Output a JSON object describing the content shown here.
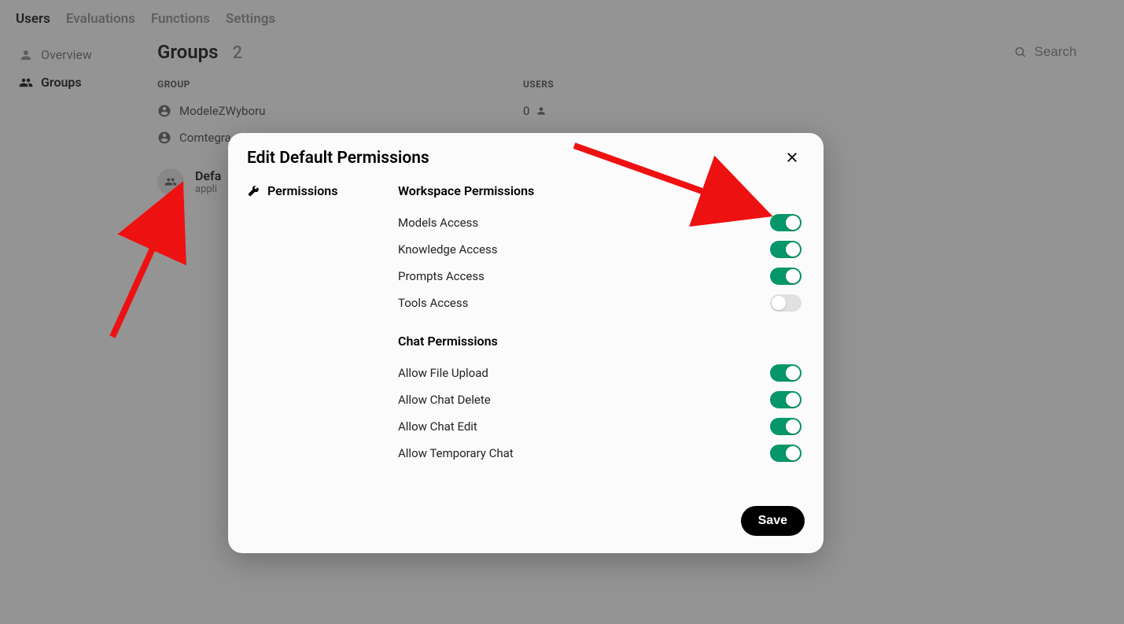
{
  "topnav": {
    "users": "Users",
    "evaluations": "Evaluations",
    "functions": "Functions",
    "settings": "Settings"
  },
  "sidebar": {
    "overview": "Overview",
    "groups": "Groups"
  },
  "page": {
    "title": "Groups",
    "count": "2"
  },
  "search": {
    "placeholder": "Search"
  },
  "table": {
    "head_group": "GROUP",
    "head_users": "USERS",
    "rows": [
      {
        "name": "ModeleZWyboru",
        "users": "0"
      },
      {
        "name": "Comtegra",
        "users": ""
      }
    ]
  },
  "default_block": {
    "title": "Defa",
    "sub": "appli"
  },
  "modal": {
    "title": "Edit Default Permissions",
    "side_permissions": "Permissions",
    "section_workspace": "Workspace Permissions",
    "section_chat": "Chat Permissions",
    "workspace": [
      {
        "label": "Models Access",
        "on": true
      },
      {
        "label": "Knowledge Access",
        "on": true
      },
      {
        "label": "Prompts Access",
        "on": true
      },
      {
        "label": "Tools Access",
        "on": false
      }
    ],
    "chat": [
      {
        "label": "Allow File Upload",
        "on": true
      },
      {
        "label": "Allow Chat Delete",
        "on": true
      },
      {
        "label": "Allow Chat Edit",
        "on": true
      },
      {
        "label": "Allow Temporary Chat",
        "on": true
      }
    ],
    "save": "Save"
  }
}
